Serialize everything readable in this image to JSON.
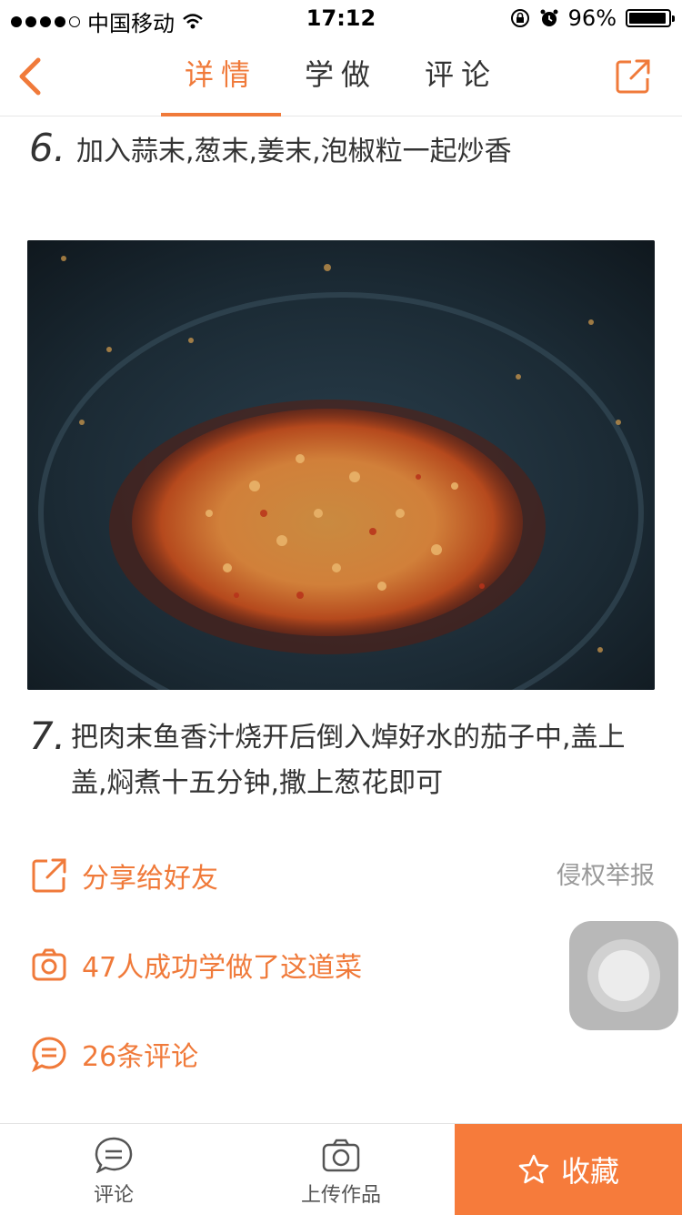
{
  "status_bar": {
    "carrier": "中国移动",
    "time": "17:12",
    "battery": "96%",
    "battery_level": 0.96
  },
  "nav": {
    "tabs": [
      {
        "label": "详情",
        "active": true
      },
      {
        "label": "学做",
        "active": false
      },
      {
        "label": "评论",
        "active": false
      }
    ]
  },
  "steps": [
    {
      "number": "6.",
      "lines": [
        "加入蒜末,葱末,姜末,泡椒粒一起炒香"
      ]
    },
    {
      "number": "7.",
      "lines": [
        "把肉末鱼香汁烧开后倒入焯好水的茄子中,盖上",
        "盖,焖煮十五分钟,撒上葱花即可"
      ]
    }
  ],
  "actions": {
    "share": "分享给好友",
    "report": "侵权举报",
    "learned": "47人成功学做了这道菜",
    "comments": "26条评论"
  },
  "bottom_bar": {
    "comment_label": "评论",
    "upload_label": "上传作品",
    "favorite_label": "收藏"
  },
  "colors": {
    "accent": "#f07a3a",
    "favorite_bg": "#f67b3b"
  },
  "icons": [
    "back-arrow-icon",
    "share-icon",
    "camera-icon",
    "comment-bubble-icon",
    "star-icon"
  ]
}
